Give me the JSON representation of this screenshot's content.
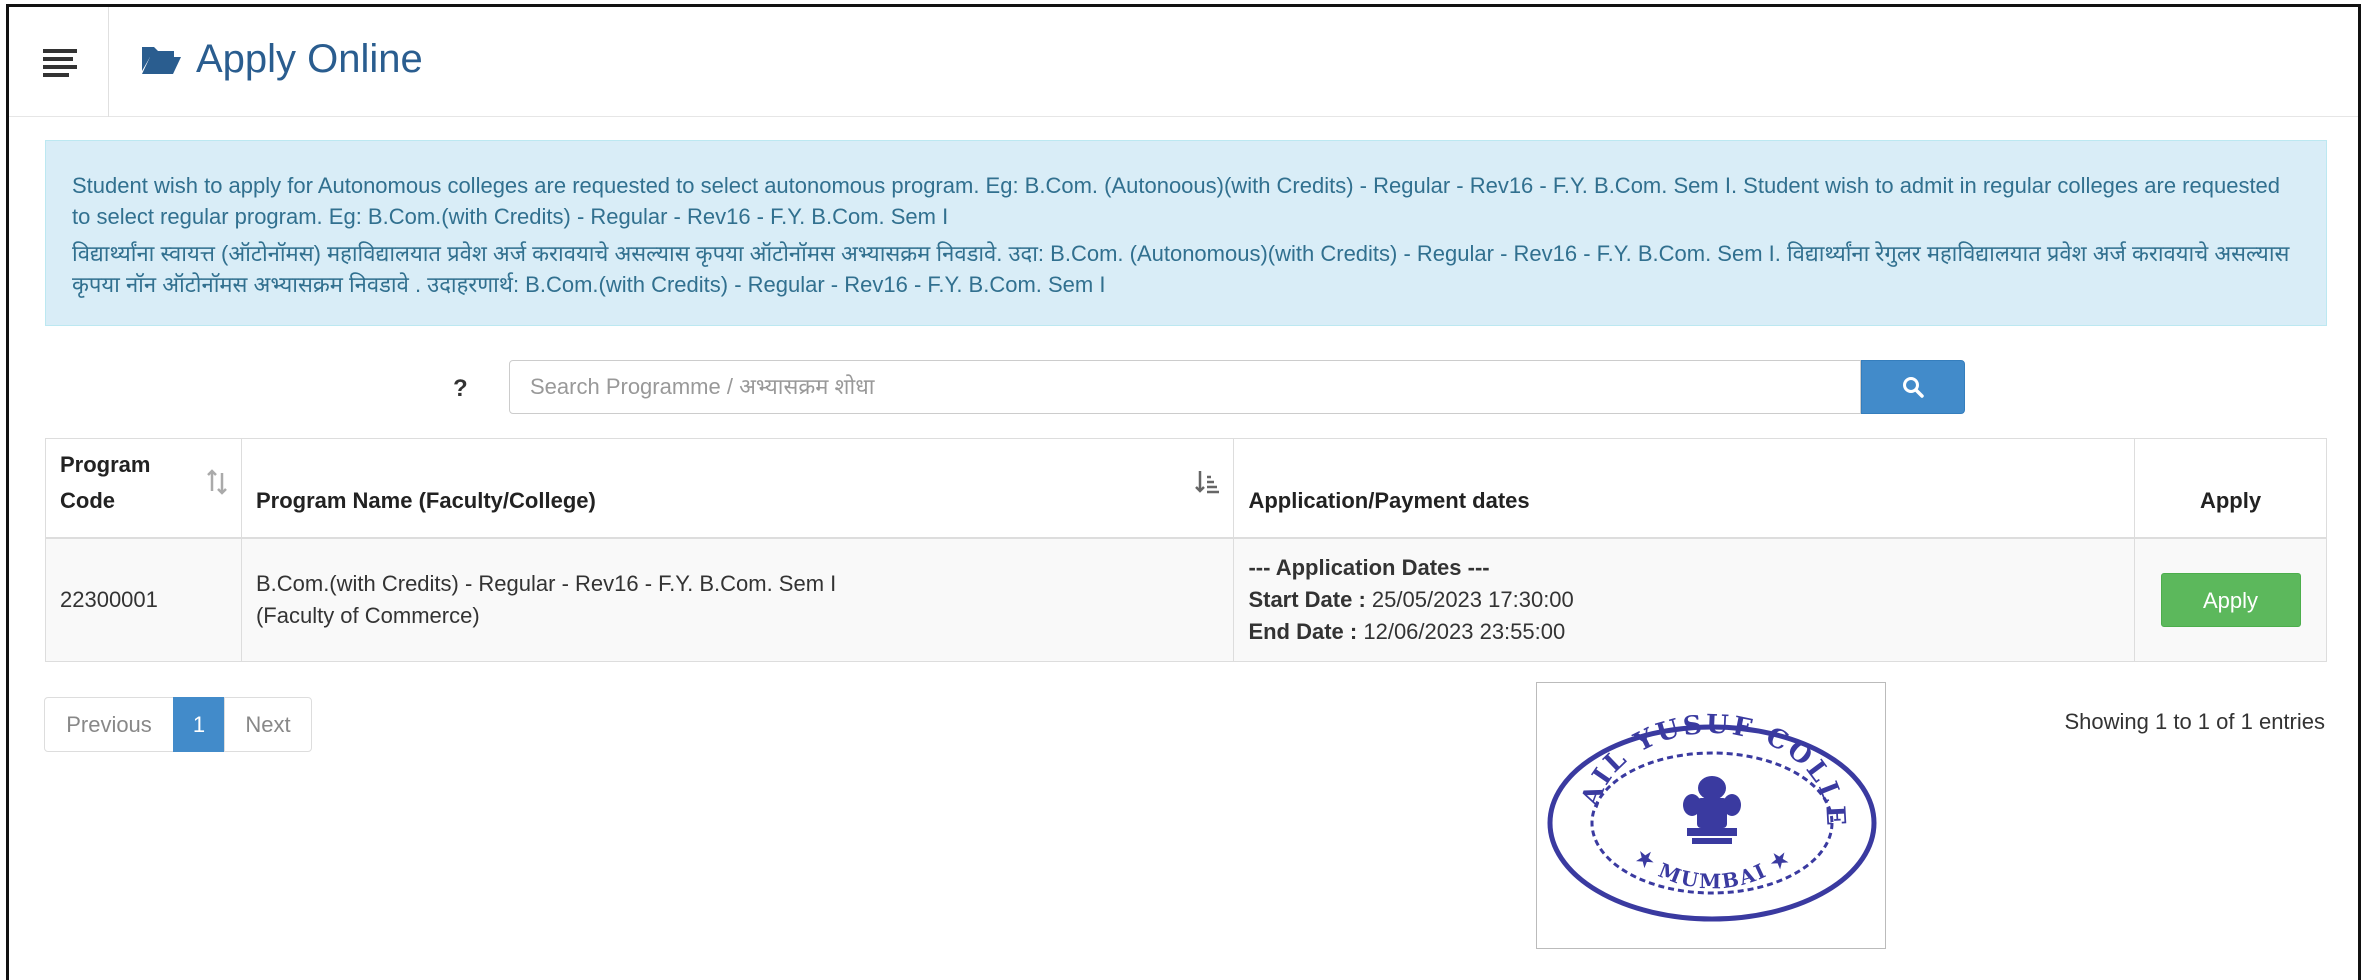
{
  "header": {
    "title": "Apply Online",
    "menu_icon": "hamburger-icon",
    "title_icon": "folder-open-icon"
  },
  "info": {
    "english": "Student wish to apply for Autonomous colleges are requested to select autonomous program. Eg: B.Com. (Autonoous)(with Credits) - Regular - Rev16 - F.Y. B.Com. Sem I. Student wish to admit in regular colleges are requested to select regular program. Eg: B.Com.(with Credits) - Regular - Rev16 - F.Y. B.Com. Sem I",
    "marathi": "विद्यार्थ्यांना स्वायत्त (ऑटोनॉमस) महाविद्यालयात प्रवेश अर्ज करावयाचे असल्यास कृपया ऑटोनॉमस अभ्यासक्रम निवडावे. उदा: B.Com. (Autonomous)(with Credits) - Regular - Rev16 - F.Y. B.Com. Sem I. विद्यार्थ्यांना रेगुलर महाविद्यालयात प्रवेश अर्ज करावयाचे असल्यास कृपया नॉन ऑटोनॉमस अभ्यासक्रम निवडावे . उदाहरणार्थ: B.Com.(with Credits) - Regular - Rev16 - F.Y. B.Com. Sem I"
  },
  "search": {
    "help_label": "?",
    "placeholder": "Search Programme / अभ्यासक्रम शोधा",
    "value": "",
    "button_icon": "search-icon"
  },
  "table": {
    "headers": {
      "code": "Program Code",
      "name": "Program Name (Faculty/College)",
      "dates": "Application/Payment dates",
      "apply": "Apply"
    },
    "rows": [
      {
        "code": "22300001",
        "name": "B.Com.(with Credits) - Regular - Rev16 - F.Y. B.Com. Sem I",
        "faculty": "(Faculty of Commerce)",
        "dates_heading": "--- Application Dates ---",
        "start_label": "Start Date :",
        "start_value": "25/05/2023 17:30:00",
        "end_label": "End Date :",
        "end_value": "12/06/2023 23:55:00",
        "apply_label": "Apply"
      }
    ]
  },
  "pagination": {
    "previous": "Previous",
    "current": "1",
    "next": "Next"
  },
  "summary": "Showing 1 to 1 of 1 entries",
  "seal": {
    "text_top": "ISMAIL YUSUF COLLEGE",
    "text_bottom": "MUMBAI",
    "color": "#3a3aa0"
  },
  "colors": {
    "title": "#2a5d8f",
    "info_bg": "#d9edf7",
    "info_text": "#31708f",
    "primary": "#428bca",
    "success": "#5cb85c"
  }
}
